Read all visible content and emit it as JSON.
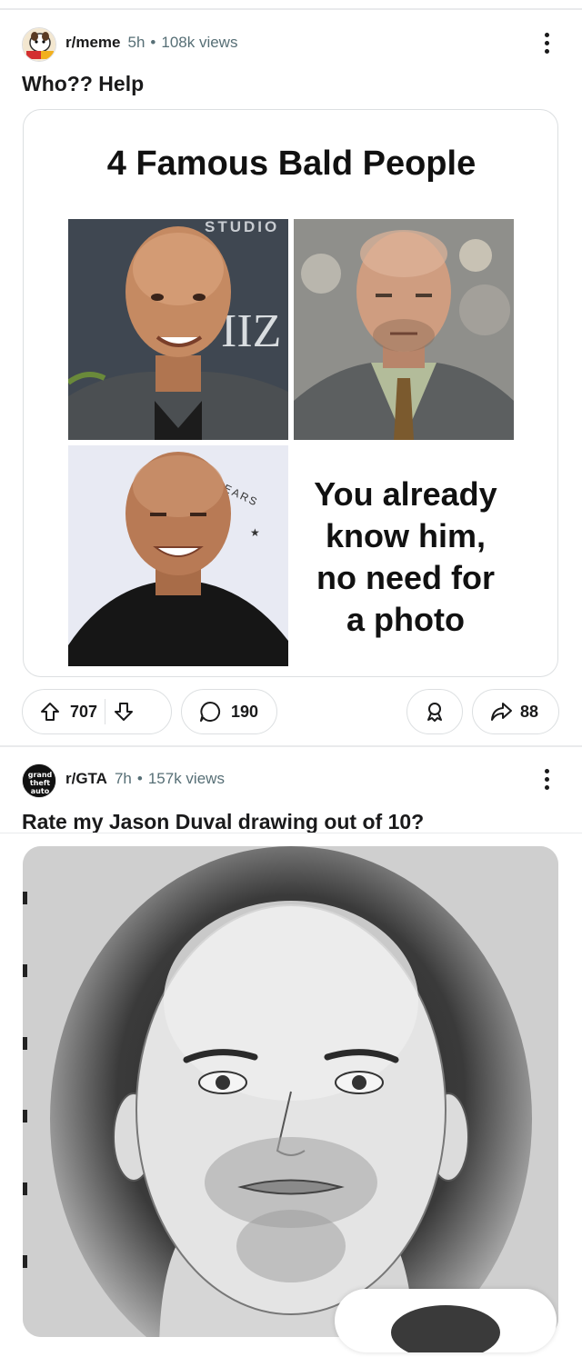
{
  "posts": [
    {
      "subreddit": "r/meme",
      "age": "5h",
      "views": "108k views",
      "title": "Who?? Help",
      "image": {
        "heading": "4 Famous Bald People",
        "caption_lines": [
          "You already",
          "know him,",
          "no need for",
          "a photo"
        ],
        "backdrop_text_1": "STUDIO",
        "backdrop_text_2": "IIZ",
        "backdrop_text_3": "EARS"
      },
      "votes": "707",
      "comments": "190",
      "shares": "88"
    },
    {
      "subreddit": "r/GTA",
      "age": "7h",
      "views": "157k views",
      "title": "Rate my Jason Duval drawing out of 10?",
      "avatar_text": [
        "grand",
        "theft",
        "auto"
      ]
    }
  ],
  "colors": {
    "text": "#1a1a1b",
    "meta": "#576f76",
    "border": "#dcdfe1"
  },
  "icons": [
    "more-vertical-icon",
    "upvote-icon",
    "downvote-icon",
    "comment-icon",
    "award-icon",
    "share-icon"
  ]
}
